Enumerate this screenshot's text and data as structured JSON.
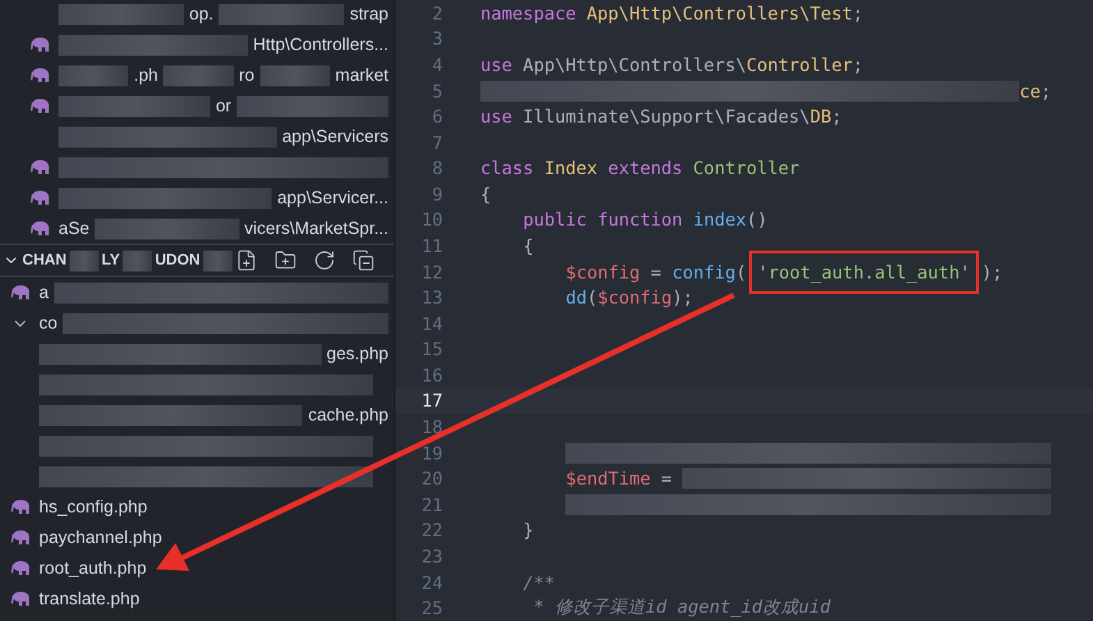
{
  "sidebar": {
    "upper_items": [
      {
        "icon": false,
        "parts": [
          {
            "kind": "blur"
          },
          {
            "kind": "text",
            "text": "op."
          },
          {
            "kind": "blur"
          },
          {
            "kind": "text",
            "text": "strap"
          }
        ]
      },
      {
        "icon": true,
        "parts": [
          {
            "kind": "blur"
          },
          {
            "kind": "text",
            "text": "Http\\Controllers..."
          }
        ]
      },
      {
        "icon": true,
        "parts": [
          {
            "kind": "blur"
          },
          {
            "kind": "text",
            "text": ".ph"
          },
          {
            "kind": "blur"
          },
          {
            "kind": "text",
            "text": "ro"
          },
          {
            "kind": "blur"
          },
          {
            "kind": "text",
            "text": "market"
          }
        ]
      },
      {
        "icon": true,
        "parts": [
          {
            "kind": "blur"
          },
          {
            "kind": "text",
            "text": "or"
          },
          {
            "kind": "blur"
          }
        ]
      },
      {
        "icon": false,
        "parts": [
          {
            "kind": "blur"
          },
          {
            "kind": "text",
            "text": "app\\Servicers"
          }
        ]
      },
      {
        "icon": true,
        "parts": [
          {
            "kind": "blur"
          }
        ]
      },
      {
        "icon": true,
        "parts": [
          {
            "kind": "blur"
          },
          {
            "kind": "text",
            "text": "app\\Servicer..."
          }
        ]
      },
      {
        "icon": true,
        "parts": [
          {
            "kind": "text",
            "text": "aSe"
          },
          {
            "kind": "blur"
          },
          {
            "kind": "text",
            "text": "vicers\\MarketSpr..."
          }
        ]
      }
    ],
    "section": {
      "expanded": true,
      "parts": [
        {
          "kind": "text",
          "text": "CHAN"
        },
        {
          "kind": "blur"
        },
        {
          "kind": "text",
          "text": "LY"
        },
        {
          "kind": "blur"
        },
        {
          "kind": "text",
          "text": "UDON"
        },
        {
          "kind": "blur"
        }
      ]
    },
    "items": [
      {
        "kind": "file",
        "icon": true,
        "parts": [
          {
            "kind": "text",
            "text": "a"
          },
          {
            "kind": "blur"
          }
        ]
      },
      {
        "kind": "folder",
        "expanded": true,
        "parts": [
          {
            "kind": "text",
            "text": "co"
          },
          {
            "kind": "blur"
          }
        ]
      },
      {
        "kind": "file",
        "icon": false,
        "parts": [
          {
            "kind": "blur"
          },
          {
            "kind": "text",
            "text": "ges.php"
          }
        ]
      },
      {
        "kind": "file",
        "icon": false,
        "parts": [
          {
            "kind": "blur"
          }
        ]
      },
      {
        "kind": "file",
        "icon": false,
        "parts": [
          {
            "kind": "blur"
          },
          {
            "kind": "text",
            "text": "cache.php"
          }
        ]
      },
      {
        "kind": "file",
        "icon": false,
        "parts": [
          {
            "kind": "blur"
          }
        ]
      },
      {
        "kind": "file",
        "icon": false,
        "parts": [
          {
            "kind": "blur"
          }
        ]
      },
      {
        "kind": "file",
        "icon": true,
        "parts": [
          {
            "kind": "text",
            "text": "hs_config.php"
          }
        ]
      },
      {
        "kind": "file",
        "icon": true,
        "parts": [
          {
            "kind": "text",
            "text": "paychannel.php"
          }
        ]
      },
      {
        "kind": "file",
        "icon": true,
        "parts": [
          {
            "kind": "text",
            "text": "root_auth.php"
          }
        ]
      },
      {
        "kind": "file",
        "icon": true,
        "parts": [
          {
            "kind": "text",
            "text": "translate.php"
          }
        ]
      }
    ]
  },
  "editor": {
    "lines": [
      {
        "number": "2",
        "current": false,
        "tokens": [
          {
            "kind": "keyword",
            "text": "namespace"
          },
          {
            "kind": "class",
            "text": " App\\Http\\Controllers\\Test"
          },
          {
            "kind": "plain",
            "text": ";"
          }
        ]
      },
      {
        "number": "3",
        "current": false
      },
      {
        "number": "4",
        "current": false,
        "tokens": [
          {
            "kind": "keyword",
            "text": "use"
          },
          {
            "kind": "plain",
            "text": " App\\Http\\Controllers\\"
          },
          {
            "kind": "class",
            "text": "Controller"
          },
          {
            "kind": "plain",
            "text": ";"
          }
        ]
      },
      {
        "number": "5",
        "current": false,
        "tokens": [
          {
            "kind": "blur"
          },
          {
            "kind": "class",
            "text": "ce"
          },
          {
            "kind": "plain",
            "text": ";"
          }
        ]
      },
      {
        "number": "6",
        "current": false,
        "tokens": [
          {
            "kind": "keyword",
            "text": "use"
          },
          {
            "kind": "plain",
            "text": " Illuminate\\Support\\Facades\\"
          },
          {
            "kind": "class",
            "text": "DB"
          },
          {
            "kind": "plain",
            "text": ";"
          }
        ]
      },
      {
        "number": "7",
        "current": false
      },
      {
        "number": "8",
        "current": false,
        "tokens": [
          {
            "kind": "keyword",
            "text": "class"
          },
          {
            "kind": "class",
            "text": " Index"
          },
          {
            "kind": "keyword",
            "text": " extends"
          },
          {
            "kind": "type",
            "text": " Controller"
          }
        ]
      },
      {
        "number": "9",
        "current": false,
        "tokens": [
          {
            "kind": "plain",
            "text": "{"
          }
        ]
      },
      {
        "number": "10",
        "current": false,
        "tokens": [
          {
            "kind": "keyword",
            "text": "    public"
          },
          {
            "kind": "keyword",
            "text": " function"
          },
          {
            "kind": "func",
            "text": " index"
          },
          {
            "kind": "plain",
            "text": "()"
          }
        ]
      },
      {
        "number": "11",
        "current": false,
        "tokens": [
          {
            "kind": "plain",
            "text": "    {"
          }
        ]
      },
      {
        "number": "12",
        "current": false,
        "tokens": [
          {
            "kind": "var",
            "text": "        $config"
          },
          {
            "kind": "plain",
            "text": " = "
          },
          {
            "kind": "func",
            "text": "config"
          },
          {
            "kind": "plain",
            "text": "("
          },
          {
            "kind": "string",
            "text": "'root_auth.all_auth'",
            "boxed": true
          },
          {
            "kind": "plain",
            "text": ");"
          }
        ]
      },
      {
        "number": "13",
        "current": false,
        "tokens": [
          {
            "kind": "func",
            "text": "        dd"
          },
          {
            "kind": "plain",
            "text": "("
          },
          {
            "kind": "var",
            "text": "$config"
          },
          {
            "kind": "plain",
            "text": ");"
          }
        ]
      },
      {
        "number": "14",
        "current": false
      },
      {
        "number": "15",
        "current": false
      },
      {
        "number": "16",
        "current": false
      },
      {
        "number": "17",
        "current": true
      },
      {
        "number": "18",
        "current": false
      },
      {
        "number": "19",
        "current": false,
        "tokens": [
          {
            "kind": "blur",
            "indent": true
          }
        ]
      },
      {
        "number": "20",
        "current": false,
        "tokens": [
          {
            "kind": "var",
            "text": "        $endTime"
          },
          {
            "kind": "plain",
            "text": " = "
          },
          {
            "kind": "blur"
          }
        ]
      },
      {
        "number": "21",
        "current": false,
        "tokens": [
          {
            "kind": "blur",
            "indent": true
          }
        ]
      },
      {
        "number": "22",
        "current": false,
        "tokens": [
          {
            "kind": "plain",
            "text": "    }"
          }
        ]
      },
      {
        "number": "23",
        "current": false
      },
      {
        "number": "24",
        "current": false,
        "tokens": [
          {
            "kind": "comment",
            "text": "    /**"
          }
        ]
      },
      {
        "number": "25",
        "current": false,
        "tokens": [
          {
            "kind": "comment",
            "text": "     * 修改子渠道id agent_id改成uid"
          }
        ]
      }
    ]
  }
}
